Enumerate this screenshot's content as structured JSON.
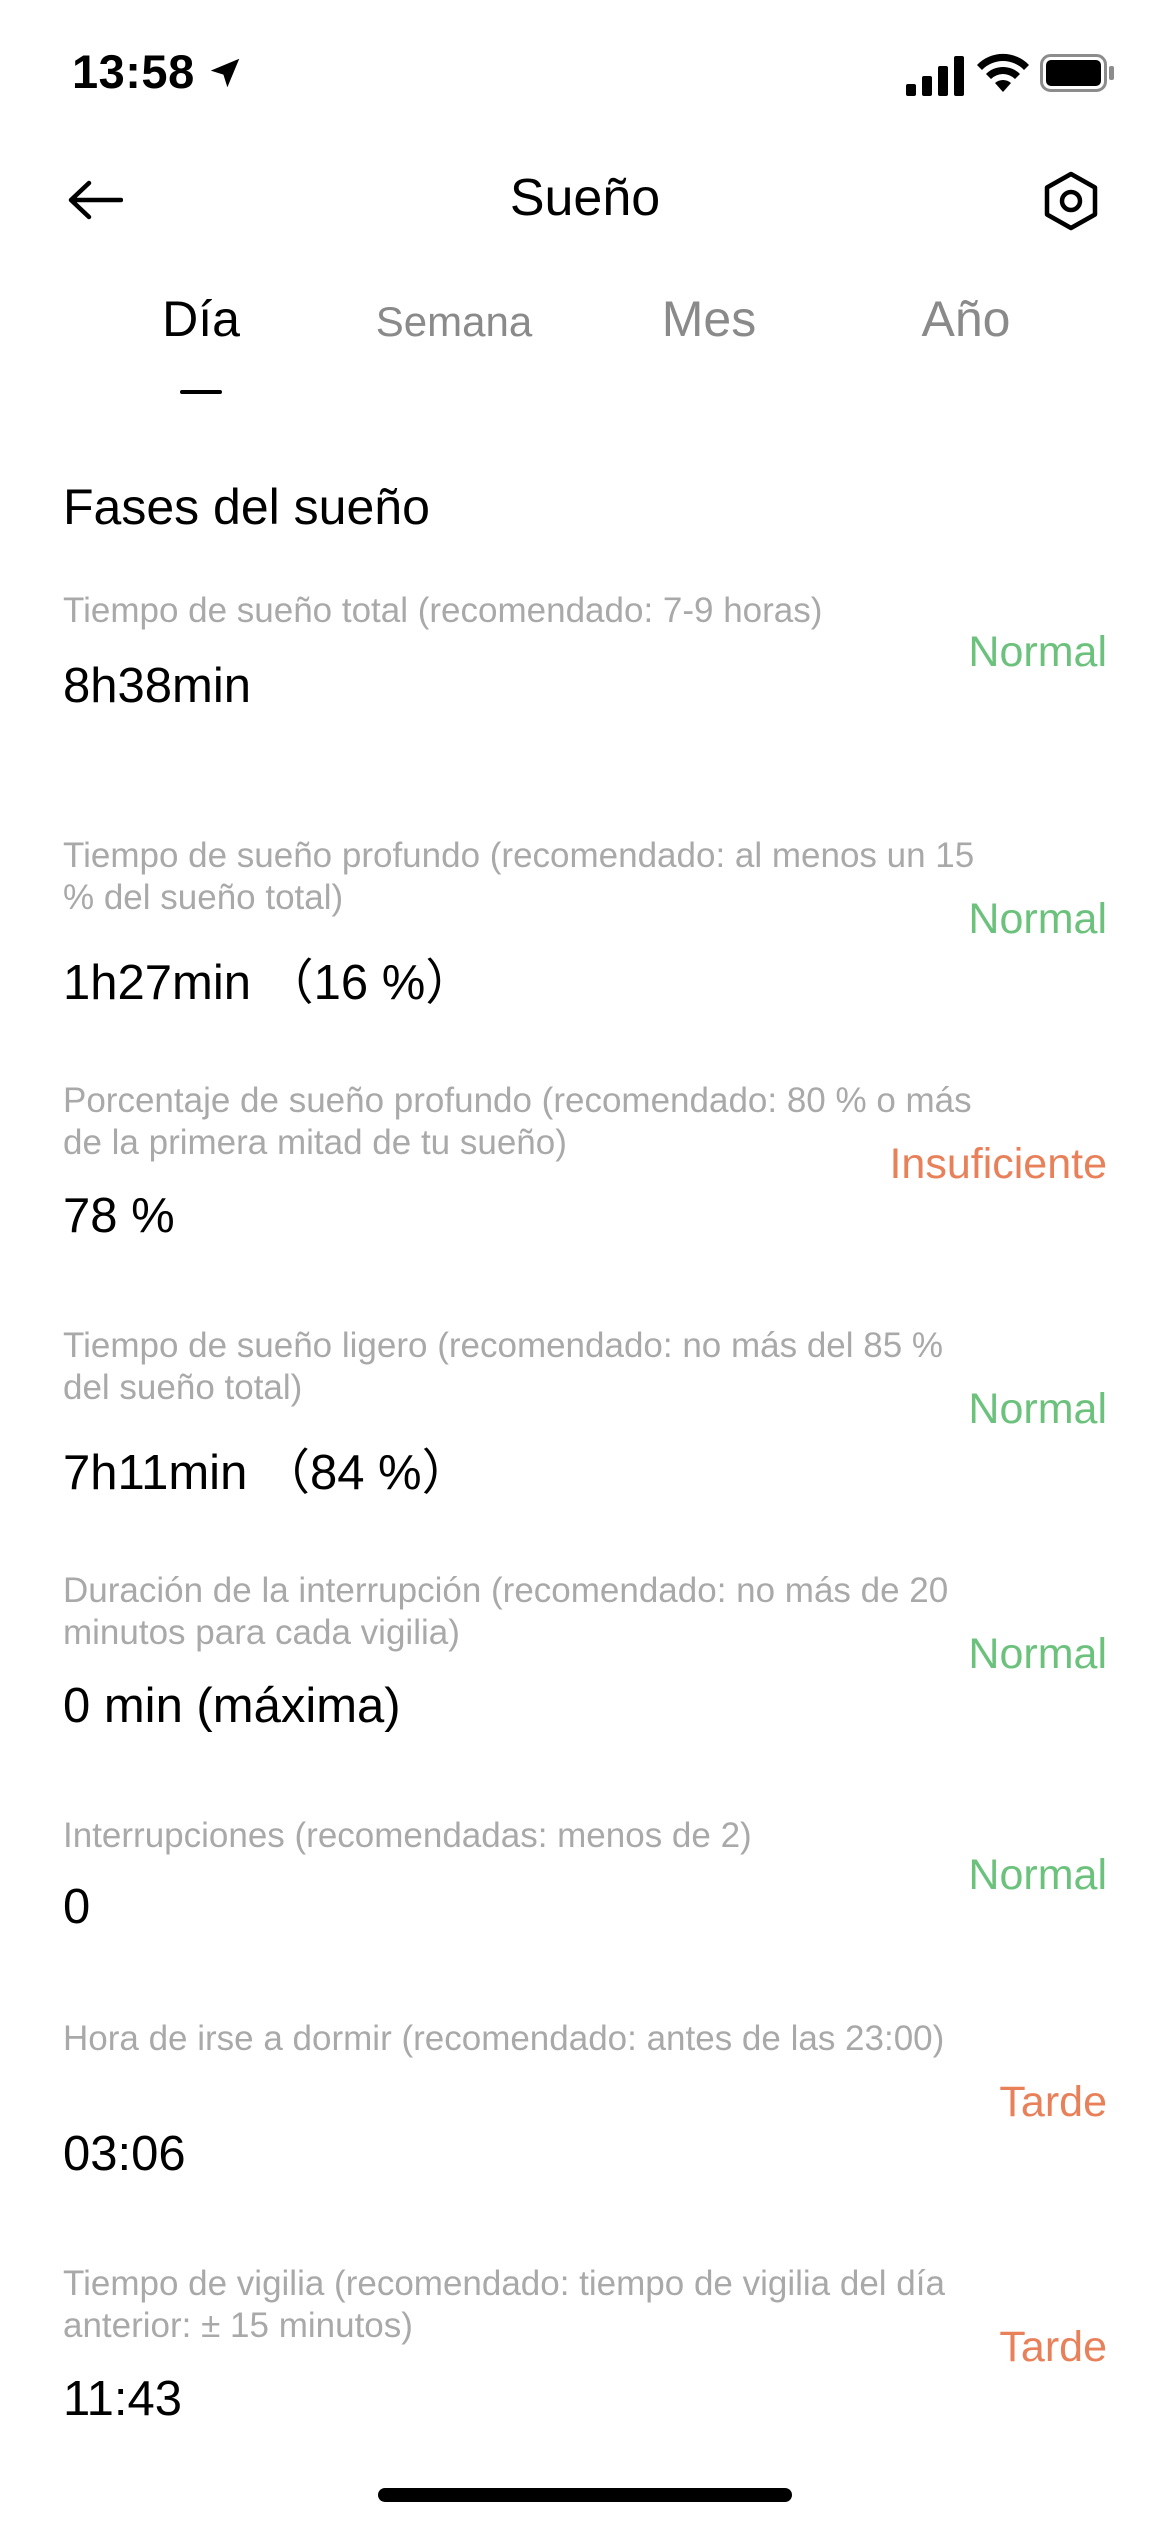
{
  "status_bar": {
    "time": "13:58"
  },
  "header": {
    "title": "Sueño"
  },
  "tabs": [
    {
      "label": "Día"
    },
    {
      "label": "Semana"
    },
    {
      "label": "Mes"
    },
    {
      "label": "Año"
    }
  ],
  "section": {
    "title": "Fases del sueño"
  },
  "metrics": [
    {
      "label": "Tiempo de sueño total (recomendado: 7-9 horas)",
      "value": "8h38min",
      "status": "Normal",
      "status_color": "#6cc27d"
    },
    {
      "label": "Tiempo de sueño profundo (recomendado: al menos un 15 % del sueño total)",
      "value": "1h27min （16 %）",
      "status": "Normal",
      "status_color": "#6cc27d"
    },
    {
      "label": "Porcentaje de sueño profundo (recomendado: 80 % o más de la primera mitad de tu sueño)",
      "value": "78 %",
      "status": "Insuficiente",
      "status_color": "#e8805a"
    },
    {
      "label": "Tiempo de sueño ligero (recomendado: no más del 85 % del sueño total)",
      "value": "7h11min （84 %）",
      "status": "Normal",
      "status_color": "#6cc27d"
    },
    {
      "label": "Duración de la interrupción (recomendado: no más de 20 minutos para cada vigilia)",
      "value": "0 min (máxima)",
      "status": "Normal",
      "status_color": "#6cc27d"
    },
    {
      "label": "Interrupciones (recomendadas: menos de 2)",
      "value": "0",
      "status": "Normal",
      "status_color": "#6cc27d"
    },
    {
      "label": "Hora de irse a dormir (recomendado: antes de las 23:00)",
      "value": "03:06",
      "status": "Tarde",
      "status_color": "#e8805a"
    },
    {
      "label": "Tiempo de vigilia (recomendado: tiempo de vigilia del día anterior: ± 15  minutos)",
      "value": "11:43",
      "status": "Tarde",
      "status_color": "#e8805a"
    }
  ]
}
